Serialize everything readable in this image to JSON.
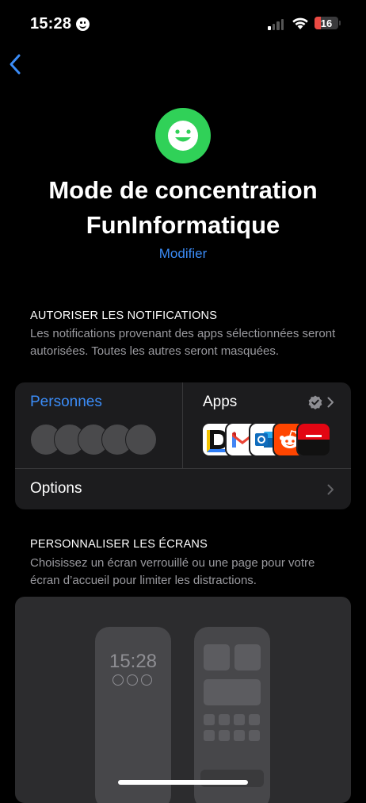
{
  "status_bar": {
    "time": "15:28",
    "battery_level": "16",
    "battery_color": "#eb4a43"
  },
  "header": {
    "back_icon": "chevron-left-icon"
  },
  "focus": {
    "icon": "smiley-face-icon",
    "icon_color": "#30d158",
    "title_line1": "Mode de concentration",
    "title_line2": "FunInformatique",
    "modify_label": "Modifier"
  },
  "allow_notifications": {
    "heading": "AUTORISER LES NOTIFICATIONS",
    "description": "Les notifications provenant des apps sélectionnées seront autorisées. Toutes les autres seront masquées.",
    "people_label": "Personnes",
    "apps_label": "Apps",
    "apps": [
      "Dashlane",
      "Gmail",
      "Outlook",
      "Reddit",
      "Banque"
    ],
    "options_label": "Options"
  },
  "customize_screens": {
    "heading": "PERSONNALISER LES ÉCRANS",
    "description": "Choisissez un écran verrouillé ou une page pour votre écran d’accueil pour limiter les distractions.",
    "lock_time": "15:28"
  },
  "colors": {
    "accent": "#3b8cf7",
    "background": "#000000",
    "card": "#1c1c1e"
  }
}
